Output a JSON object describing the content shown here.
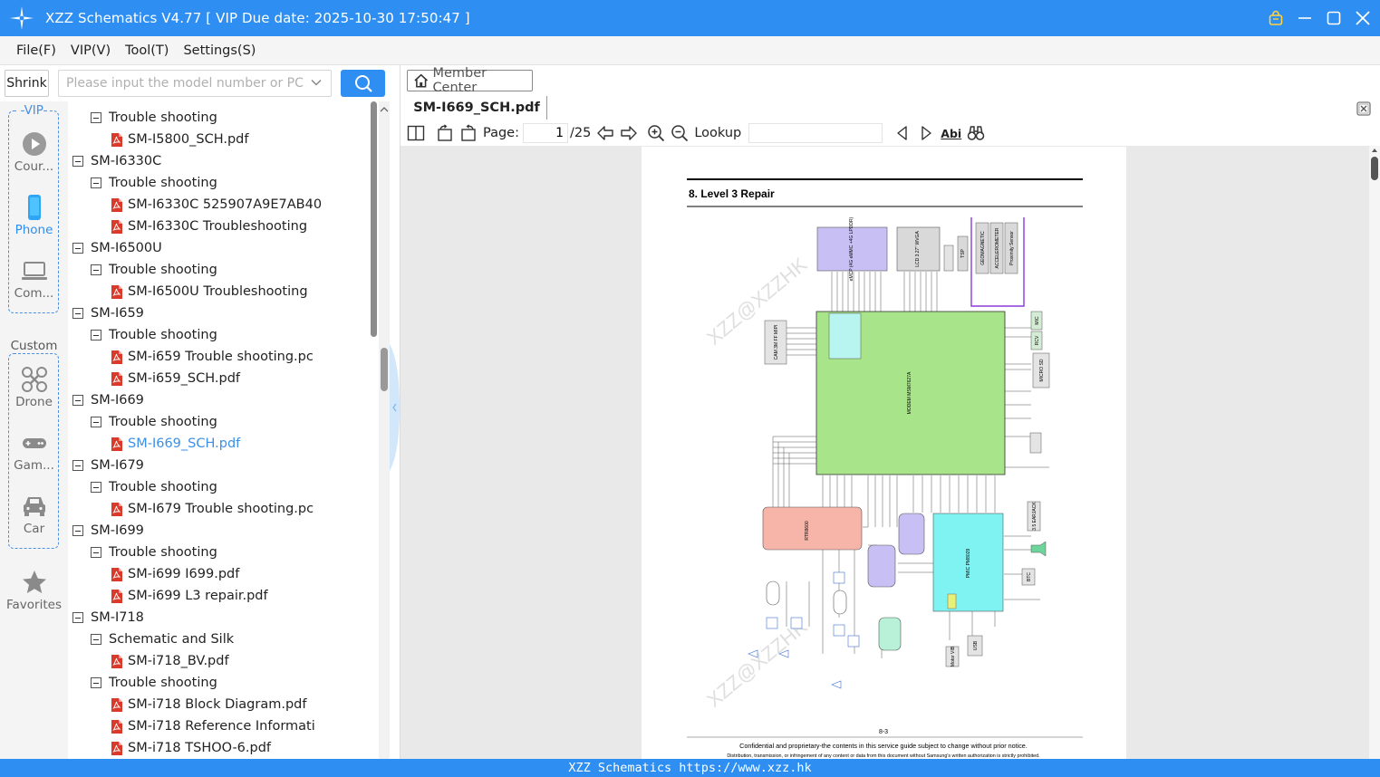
{
  "window": {
    "title": "XZZ Schematics V4.77 [ VIP Due date: 2025-10-30 17:50:47 ]"
  },
  "menu": [
    "File(F)",
    "VIP(V)",
    "Tool(T)",
    "Settings(S)"
  ],
  "search": {
    "shrink_label": "Shrink",
    "placeholder": "Please input the model number or PCB"
  },
  "rail": {
    "vip_label": "-VIP-",
    "vip_items": [
      "Cour...",
      "Phone",
      "Com..."
    ],
    "custom_label": "Custom",
    "custom_items": [
      "Drone",
      "Gam...",
      "Car"
    ],
    "favorites": "Favorites"
  },
  "tree": [
    {
      "level": 1,
      "kind": "folder",
      "text": "Trouble shooting"
    },
    {
      "level": 2,
      "kind": "pdf",
      "text": "SM-I5800_SCH.pdf"
    },
    {
      "level": 0,
      "kind": "folder",
      "text": "SM-I6330C"
    },
    {
      "level": 1,
      "kind": "folder",
      "text": "Trouble shooting"
    },
    {
      "level": 2,
      "kind": "pdf",
      "text": "SM-I6330C 525907A9E7AB40"
    },
    {
      "level": 2,
      "kind": "pdf",
      "text": "SM-I6330C Troubleshooting"
    },
    {
      "level": 0,
      "kind": "folder",
      "text": "SM-I6500U"
    },
    {
      "level": 1,
      "kind": "folder",
      "text": "Trouble shooting"
    },
    {
      "level": 2,
      "kind": "pdf",
      "text": "SM-I6500U Troubleshooting"
    },
    {
      "level": 0,
      "kind": "folder",
      "text": "SM-I659"
    },
    {
      "level": 1,
      "kind": "folder",
      "text": "Trouble shooting"
    },
    {
      "level": 2,
      "kind": "pdf",
      "text": "SM-i659 Trouble shooting.pc"
    },
    {
      "level": 2,
      "kind": "pdf",
      "text": "SM-i659_SCH.pdf"
    },
    {
      "level": 0,
      "kind": "folder",
      "text": "SM-I669"
    },
    {
      "level": 1,
      "kind": "folder",
      "text": "Trouble shooting"
    },
    {
      "level": 2,
      "kind": "pdf",
      "text": "SM-I669_SCH.pdf",
      "selected": true
    },
    {
      "level": 0,
      "kind": "folder",
      "text": "SM-I679"
    },
    {
      "level": 1,
      "kind": "folder",
      "text": "Trouble shooting"
    },
    {
      "level": 2,
      "kind": "pdf",
      "text": "SM-I679 Trouble shooting.pc"
    },
    {
      "level": 0,
      "kind": "folder",
      "text": "SM-I699"
    },
    {
      "level": 1,
      "kind": "folder",
      "text": "Trouble shooting"
    },
    {
      "level": 2,
      "kind": "pdf",
      "text": "SM-i699 I699.pdf"
    },
    {
      "level": 2,
      "kind": "pdf",
      "text": "SM-i699 L3 repair.pdf"
    },
    {
      "level": 0,
      "kind": "folder",
      "text": "SM-I718"
    },
    {
      "level": 1,
      "kind": "folder",
      "text": "Schematic and Silk"
    },
    {
      "level": 2,
      "kind": "pdf",
      "text": "SM-i718_BV.pdf"
    },
    {
      "level": 1,
      "kind": "folder",
      "text": "Trouble shooting"
    },
    {
      "level": 2,
      "kind": "pdf",
      "text": "SM-i718 Block Diagram.pdf"
    },
    {
      "level": 2,
      "kind": "pdf",
      "text": "SM-i718 Reference Informati"
    },
    {
      "level": 2,
      "kind": "pdf",
      "text": "SM-i718 TSHOO-6.pdf"
    }
  ],
  "viewer": {
    "member_center": "Member Center",
    "tab": "SM-I669_SCH.pdf",
    "page_label": "Page:",
    "page_current": "1",
    "page_total": "/25",
    "lookup_label": "Lookup",
    "abi": "Abi"
  },
  "document": {
    "heading": "8. Level 3 Repair",
    "page_number": "8-3",
    "footer_line1": "Confidential and proprietary-the contents in this service guide subject to change without prior notice.",
    "footer_line2": "Distribution, transmission, or infringement of any content or data from this document without Samsung's written authorization is strictly prohibited.",
    "watermark": "XZZ@XZZHK",
    "blocks": {
      "modem": "MODEM MSM7627A",
      "pmic": "PMIC PM8029",
      "emcp": "eMCP (4G eMMC +4G LPDDR)",
      "lcd": "LCD 3.27\" WVGA",
      "tsp": "TSP",
      "cam": "CAM 3M FF MIPI",
      "sensors": [
        "GEOMAGNETIC",
        "ACCELEROMETER",
        "Proximity Sensor"
      ],
      "rf": "RTR8600",
      "mic": "MIC",
      "rcv": "RCV",
      "micro_sd": "MICRO SD",
      "earjack": "3.5 EARJACK",
      "vib": "Motor VIB",
      "usb": "USB",
      "btc": "BTC"
    }
  },
  "footer": {
    "text": "XZZ Schematics https://www.xzz.hk"
  },
  "colors": {
    "accent": "#2e8ef1",
    "selected_text": "#3d8fe6",
    "modem_block": "#a8e48a",
    "pmic_block": "#7ff2f2",
    "rf_block": "#f7b4a8"
  }
}
